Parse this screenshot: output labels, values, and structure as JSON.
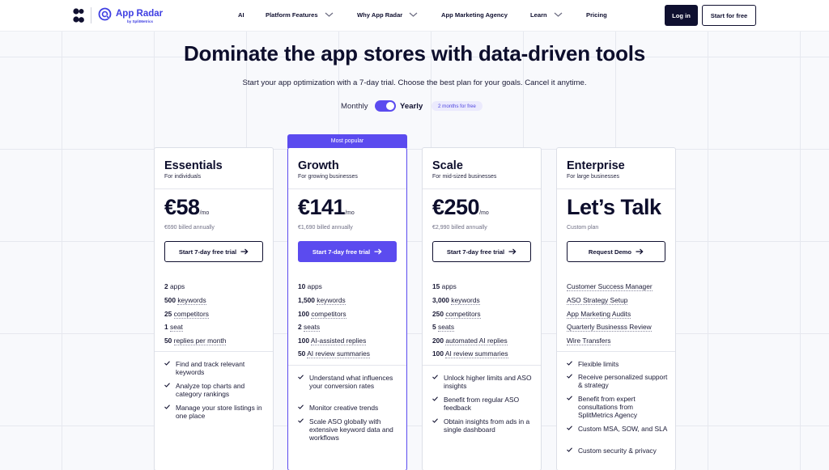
{
  "nav": {
    "brand": "App Radar",
    "brand_sub": "by SplitMetrics",
    "items": [
      "AI",
      "Platform Features",
      "Why App Radar",
      "App Marketing Agency",
      "Learn",
      "Pricing"
    ],
    "login": "Log in",
    "start": "Start for free"
  },
  "hero": {
    "title": "Dominate the app stores with data-driven tools",
    "subtitle": "Start your app optimization with a 7-day trial. Choose the best plan for your goals. Cancel it anytime.",
    "monthly": "Monthly",
    "yearly": "Yearly",
    "promo": "2 months for free"
  },
  "colors": {
    "accent": "#5b4bef",
    "dark": "#0f1030"
  },
  "plans": [
    {
      "name": "Essentials",
      "for": "For individuals",
      "price": "€58",
      "unit": "/mo",
      "billed": "€690 billed annually",
      "cta": "Start 7-day free trial",
      "limits": [
        {
          "num": "2",
          "label": "apps"
        },
        {
          "num": "500",
          "label": "keywords"
        },
        {
          "num": "25",
          "label": "competitors"
        },
        {
          "num": "1",
          "label": "seat"
        },
        {
          "num": "50",
          "label": "replies per month"
        }
      ],
      "features": [
        "Find and track relevant keywords",
        "Analyze top charts and category rankings",
        "Manage your store listings in one place"
      ]
    },
    {
      "name": "Growth",
      "for": "For growing businesses",
      "badge": "Most popular",
      "price": "€141",
      "unit": "/mo",
      "billed": "€1,690 billed annually",
      "cta": "Start 7-day free trial",
      "limits": [
        {
          "num": "10",
          "label": "apps"
        },
        {
          "num": "1,500",
          "label": "keywords"
        },
        {
          "num": "100",
          "label": "competitors"
        },
        {
          "num": "2",
          "label": "seats"
        },
        {
          "num": "100",
          "label": "AI-assisted replies"
        },
        {
          "num": "50",
          "label": "AI review summaries"
        }
      ],
      "features": [
        "Understand what influences your conversion rates",
        "Monitor creative trends",
        "Scale ASO globally with extensive keyword data and workflows"
      ]
    },
    {
      "name": "Scale",
      "for": "For mid-sized businesses",
      "price": "€250",
      "unit": "/mo",
      "billed": "€2,990 billed annually",
      "cta": "Start 7-day free trial",
      "limits": [
        {
          "num": "15",
          "label": "apps"
        },
        {
          "num": "3,000",
          "label": "keywords"
        },
        {
          "num": "250",
          "label": "competitors"
        },
        {
          "num": "5",
          "label": "seats"
        },
        {
          "num": "200",
          "label": "automated AI replies"
        },
        {
          "num": "100",
          "label": "AI review summaries"
        }
      ],
      "features": [
        "Unlock higher limits and ASO insights",
        "Benefit from regular ASO feedback",
        "Obtain insights from ads in a single dashboard"
      ]
    },
    {
      "name": "Enterprise",
      "for": "For large businesses",
      "price": "Let’s Talk",
      "unit": "",
      "billed": "Custom plan",
      "cta": "Request Demo",
      "limits": [
        {
          "num": "",
          "label": "Customer Success Manager"
        },
        {
          "num": "",
          "label": "ASO Strategy Setup"
        },
        {
          "num": "",
          "label": "App Marketing Audits"
        },
        {
          "num": "",
          "label": "Quarterly Businesss Review"
        },
        {
          "num": "",
          "label": "Wire Transfers"
        }
      ],
      "features": [
        "Flexible limits",
        "Receive personalized support & strategy",
        "Benefit from expert consultations from SplitMetrics Agency",
        "Custom MSA, SOW, and SLA",
        "Custom security & privacy"
      ]
    }
  ]
}
